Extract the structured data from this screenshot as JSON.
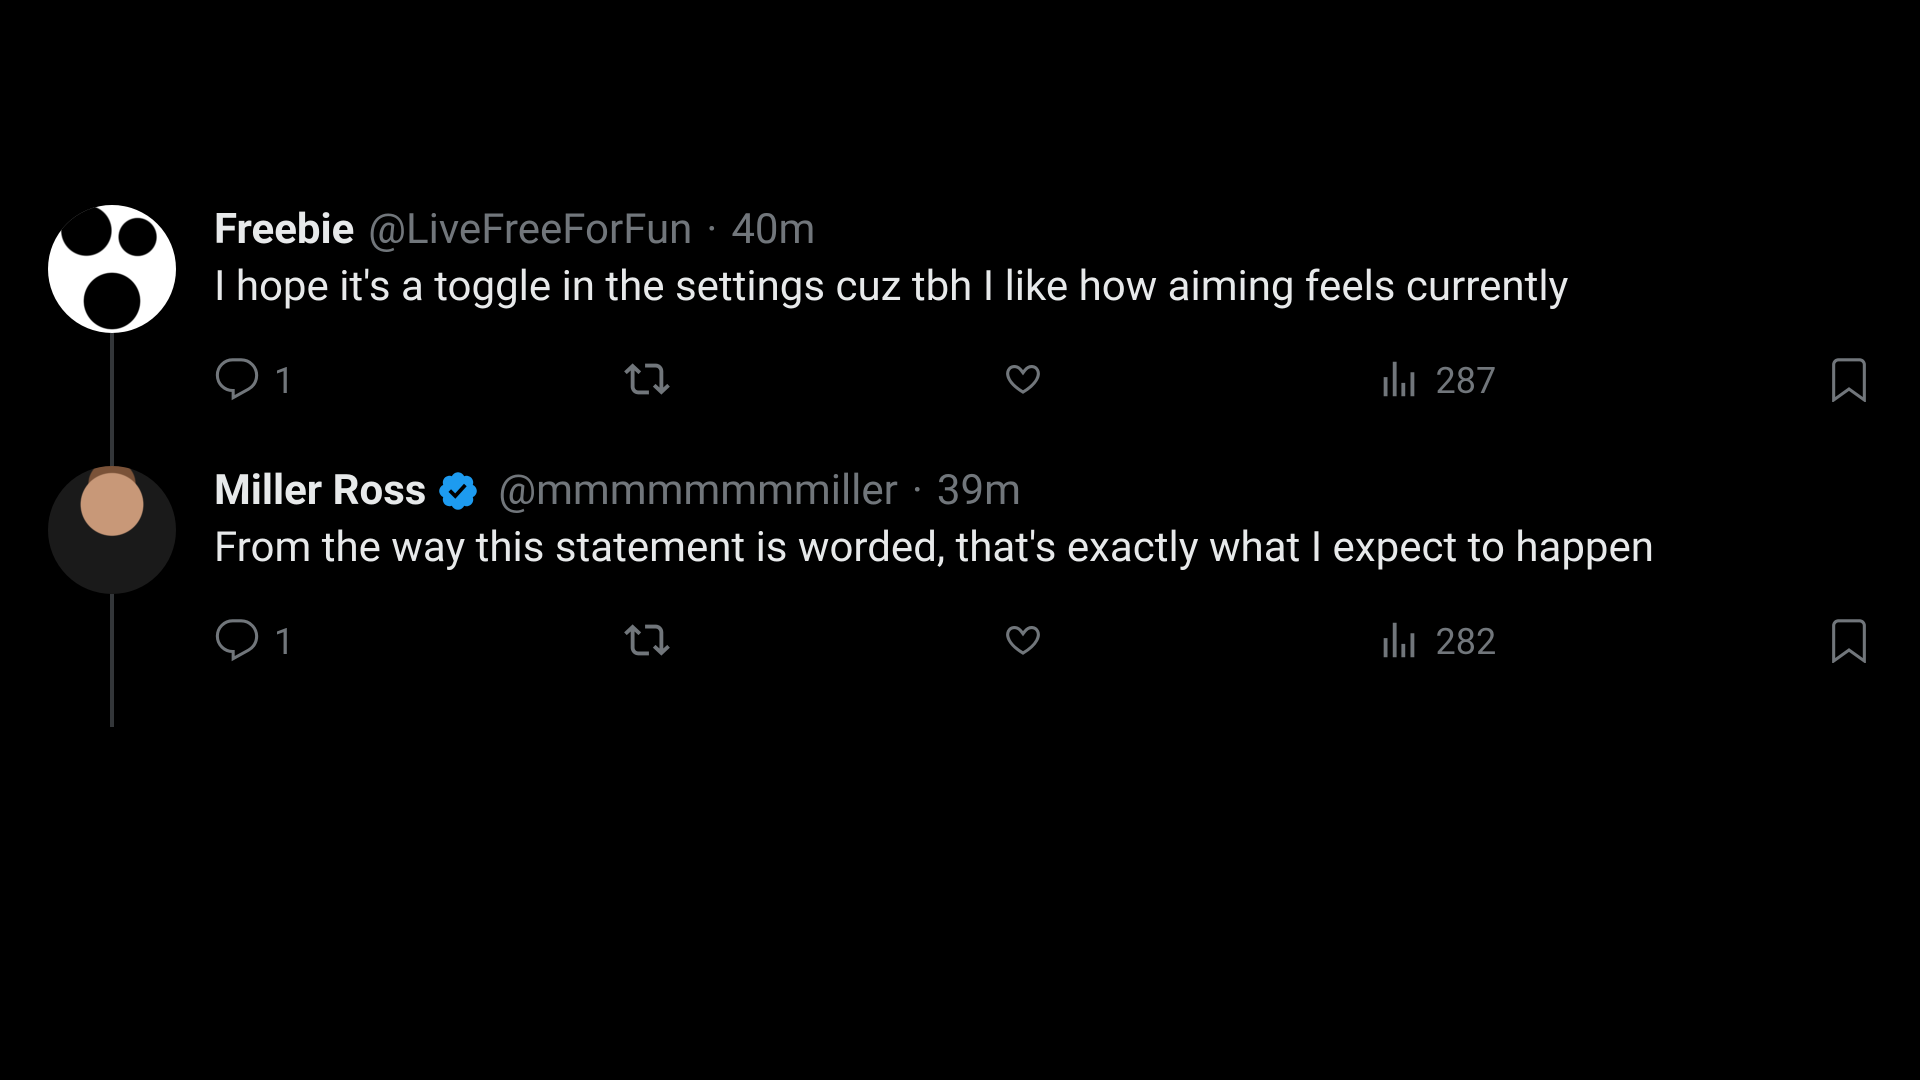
{
  "tweets": [
    {
      "display_name": "Freebie",
      "handle": "@LiveFreeForFun",
      "time": "40m",
      "sep": " · ",
      "verified": false,
      "text": "I hope it's a toggle in the settings cuz tbh I like how aiming feels currently",
      "reply_count": "1",
      "views": "287"
    },
    {
      "display_name": "Miller Ross",
      "handle": "@mmmmmmmmiller",
      "time": "39m",
      "sep": " · ",
      "verified": true,
      "text": "From the way this statement is worded, that's exactly what I expect to happen",
      "reply_count": "1",
      "views": "282"
    }
  ]
}
